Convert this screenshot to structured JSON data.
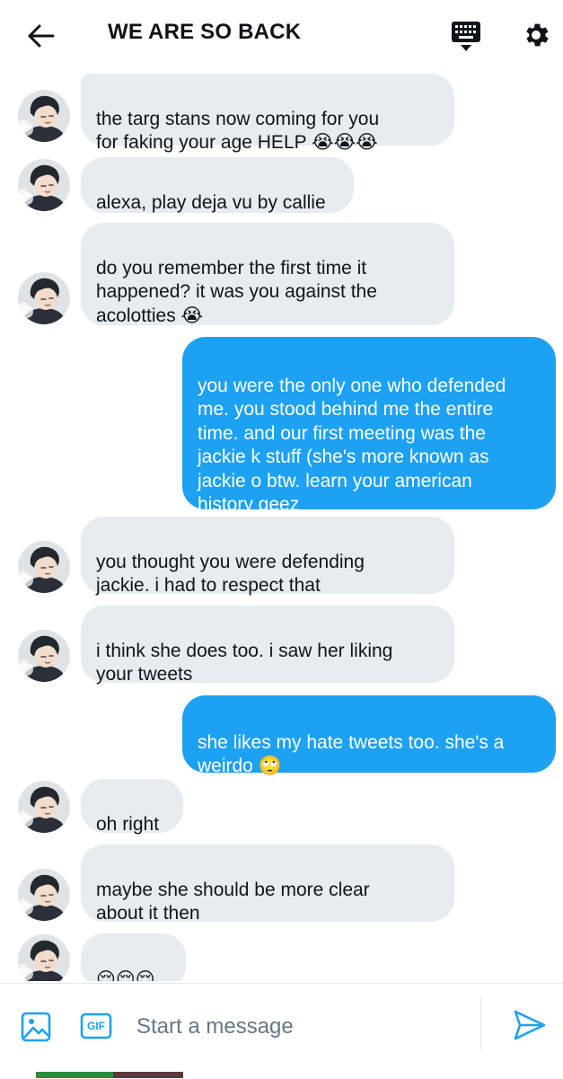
{
  "header": {
    "title": "WE ARE SO BACK",
    "back_icon": "arrow-left-icon",
    "keyboard_icon": "keyboard-icon",
    "settings_icon": "gear-icon"
  },
  "messages": [
    {
      "direction": "in",
      "text": "the targ stans now coming for you\nfor faking your age HELP 😭😭😭"
    },
    {
      "direction": "in",
      "text": "alexa, play deja vu by callie"
    },
    {
      "direction": "in",
      "text": "do you remember the first time it\nhappened? it was you against the\nacolotties 😭"
    },
    {
      "direction": "out",
      "text": "you were the only one who defended\nme. you stood behind me the entire\ntime. and our first meeting was the\njackie k stuff (she's more known as\njackie o btw. learn your american\nhistory geez"
    },
    {
      "direction": "in",
      "text": "you thought you were defending\njackie. i had to respect that"
    },
    {
      "direction": "in",
      "text": "i think she does too. i saw her liking\nyour tweets"
    },
    {
      "direction": "out",
      "text": "she likes my hate tweets too. she's a\nweirdo 🙄"
    },
    {
      "direction": "in",
      "text": "oh right"
    },
    {
      "direction": "in",
      "text": "maybe she should be more clear\nabout it then"
    },
    {
      "direction": "in",
      "text": "😌😌😌"
    }
  ],
  "composer": {
    "placeholder": "Start a message",
    "image_icon": "image-icon",
    "gif_label": "GIF",
    "send_icon": "send-icon"
  },
  "colors": {
    "accent": "#1da1f2",
    "incoming_bubble": "#e6ecf0",
    "text": "#0f1419",
    "secondary_text": "#657786"
  }
}
